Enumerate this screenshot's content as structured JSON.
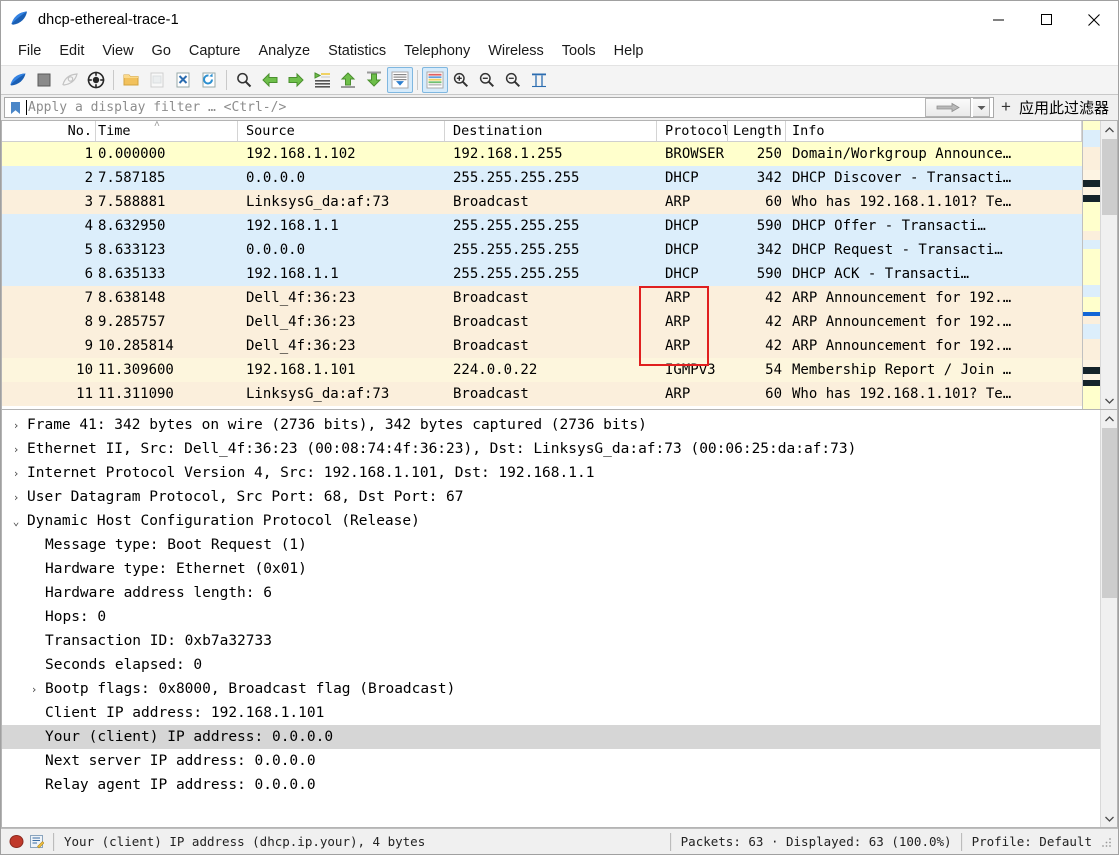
{
  "window": {
    "title": "dhcp-ethereal-trace-1",
    "app_icon": "wireshark-fin-icon",
    "minimize_label": "–",
    "maximize_label": "□",
    "close_label": "✕"
  },
  "menubar": {
    "items": [
      {
        "label": "File",
        "name": "menu-file"
      },
      {
        "label": "Edit",
        "name": "menu-edit"
      },
      {
        "label": "View",
        "name": "menu-view"
      },
      {
        "label": "Go",
        "name": "menu-go"
      },
      {
        "label": "Capture",
        "name": "menu-capture"
      },
      {
        "label": "Analyze",
        "name": "menu-analyze"
      },
      {
        "label": "Statistics",
        "name": "menu-statistics"
      },
      {
        "label": "Telephony",
        "name": "menu-telephony"
      },
      {
        "label": "Wireless",
        "name": "menu-wireless"
      },
      {
        "label": "Tools",
        "name": "menu-tools"
      },
      {
        "label": "Help",
        "name": "menu-help"
      }
    ]
  },
  "toolbar": {
    "buttons": [
      {
        "icon": "start-capture-icon",
        "enabled": true
      },
      {
        "icon": "stop-capture-icon",
        "enabled": true
      },
      {
        "icon": "restart-capture-icon",
        "enabled": false
      },
      {
        "icon": "capture-options-icon",
        "enabled": true
      },
      {
        "sep": true
      },
      {
        "icon": "open-file-icon",
        "enabled": true
      },
      {
        "icon": "save-file-icon",
        "enabled": false
      },
      {
        "icon": "close-file-icon",
        "enabled": true
      },
      {
        "icon": "reload-file-icon",
        "enabled": true
      },
      {
        "sep": true
      },
      {
        "icon": "find-packet-icon",
        "enabled": true
      },
      {
        "icon": "go-back-icon",
        "enabled": true
      },
      {
        "icon": "go-forward-icon",
        "enabled": true
      },
      {
        "icon": "go-to-packet-icon",
        "enabled": true
      },
      {
        "icon": "go-first-packet-icon",
        "enabled": true
      },
      {
        "icon": "go-last-packet-icon",
        "enabled": true
      },
      {
        "icon": "autoscroll-icon",
        "enabled": true,
        "active": true
      },
      {
        "sep": true
      },
      {
        "icon": "colorize-icon",
        "enabled": true,
        "active": true
      },
      {
        "icon": "zoom-in-icon",
        "enabled": true
      },
      {
        "icon": "zoom-out-icon",
        "enabled": true
      },
      {
        "icon": "zoom-reset-icon",
        "enabled": true
      },
      {
        "icon": "resize-columns-icon",
        "enabled": true
      }
    ]
  },
  "filter_bar": {
    "bookmark_icon": "filter-bookmark-icon",
    "value": "",
    "placeholder": "Apply a display filter … <Ctrl-/>",
    "apply_icon": "apply-arrow-icon",
    "dropdown_icon": "chevron-down-icon",
    "add_button_label": "+",
    "hint_label": "应用此过滤器"
  },
  "packet_list": {
    "columns": [
      {
        "label": "No.",
        "name": "column-no"
      },
      {
        "label": "Time",
        "name": "column-time"
      },
      {
        "label": "Source",
        "name": "column-source"
      },
      {
        "label": "Destination",
        "name": "column-destination"
      },
      {
        "label": "Protocol",
        "name": "column-protocol"
      },
      {
        "label": "Length",
        "name": "column-length"
      },
      {
        "label": "Info",
        "name": "column-info"
      }
    ],
    "sorted_column": "Time",
    "sort_indicator": "˄",
    "rows": [
      {
        "no": "1",
        "time": "0.000000",
        "source": "192.168.1.102",
        "destination": "192.168.1.255",
        "protocol": "BROWSER",
        "length": "250",
        "info": "Domain/Workgroup Announce…",
        "bg": "#ffffcc"
      },
      {
        "no": "2",
        "time": "7.587185",
        "source": "0.0.0.0",
        "destination": "255.255.255.255",
        "protocol": "DHCP",
        "length": "342",
        "info": "DHCP Discover  - Transacti…",
        "bg": "#dceefb"
      },
      {
        "no": "3",
        "time": "7.588881",
        "source": "LinksysG_da:af:73",
        "destination": "Broadcast",
        "protocol": "ARP",
        "length": "60",
        "info": "Who has 192.168.1.101? Te…",
        "bg": "#fbefdc"
      },
      {
        "no": "4",
        "time": "8.632950",
        "source": "192.168.1.1",
        "destination": "255.255.255.255",
        "protocol": "DHCP",
        "length": "590",
        "info": "DHCP Offer     - Transacti…",
        "bg": "#dceefb"
      },
      {
        "no": "5",
        "time": "8.633123",
        "source": "0.0.0.0",
        "destination": "255.255.255.255",
        "protocol": "DHCP",
        "length": "342",
        "info": "DHCP Request   - Transacti…",
        "bg": "#dceefb"
      },
      {
        "no": "6",
        "time": "8.635133",
        "source": "192.168.1.1",
        "destination": "255.255.255.255",
        "protocol": "DHCP",
        "length": "590",
        "info": "DHCP ACK       - Transacti…",
        "bg": "#dceefb"
      },
      {
        "no": "7",
        "time": "8.638148",
        "source": "Dell_4f:36:23",
        "destination": "Broadcast",
        "protocol": "ARP",
        "length": "42",
        "info": "ARP Announcement for 192.…",
        "bg": "#fbefdc"
      },
      {
        "no": "8",
        "time": "9.285757",
        "source": "Dell_4f:36:23",
        "destination": "Broadcast",
        "protocol": "ARP",
        "length": "42",
        "info": "ARP Announcement for 192.…",
        "bg": "#fbefdc"
      },
      {
        "no": "9",
        "time": "10.285814",
        "source": "Dell_4f:36:23",
        "destination": "Broadcast",
        "protocol": "ARP",
        "length": "42",
        "info": "ARP Announcement for 192.…",
        "bg": "#fbefdc"
      },
      {
        "no": "10",
        "time": "11.309600",
        "source": "192.168.1.101",
        "destination": "224.0.0.22",
        "protocol": "IGMPv3",
        "length": "54",
        "info": "Membership Report / Join …",
        "bg": "#fdf6dd"
      },
      {
        "no": "11",
        "time": "11.311090",
        "source": "LinksysG_da:af:73",
        "destination": "Broadcast",
        "protocol": "ARP",
        "length": "60",
        "info": "Who has 192.168.1.101? Te…",
        "bg": "#fbefdc"
      }
    ],
    "packet_map_bands": [
      {
        "color": "#ffffcc",
        "h": 10
      },
      {
        "color": "#dceefb",
        "h": 18
      },
      {
        "color": "#fbefdc",
        "h": 10
      },
      {
        "color": "#fbefdc",
        "h": 14
      },
      {
        "color": "#fdf4e3",
        "h": 10
      },
      {
        "color": "#15242b",
        "h": 8
      },
      {
        "color": "#fdf4e3",
        "h": 8
      },
      {
        "color": "#15242b",
        "h": 8
      },
      {
        "color": "#ffffcc",
        "h": 30
      },
      {
        "color": "#fbefdc",
        "h": 10
      },
      {
        "color": "#dceefb",
        "h": 10
      },
      {
        "color": "#ffffcc",
        "h": 38
      },
      {
        "color": "#dceefb",
        "h": 12
      },
      {
        "color": "#ffffcc",
        "h": 16
      },
      {
        "color": "#1266d6",
        "h": 5
      },
      {
        "color": "#fbefdc",
        "h": 8
      },
      {
        "color": "#dceefb",
        "h": 16
      },
      {
        "color": "#fbefdc",
        "h": 22
      },
      {
        "color": "#fdf4e3",
        "h": 8
      },
      {
        "color": "#15242b",
        "h": 7
      },
      {
        "color": "#fdf4e3",
        "h": 6
      },
      {
        "color": "#15242b",
        "h": 7
      },
      {
        "color": "#ffffcc",
        "h": 24
      }
    ],
    "annotation": {
      "name": "red-highlight-box",
      "color": "#e01f1f"
    }
  },
  "detail_pane": {
    "rows": [
      {
        "twisty": "›",
        "indent": 0,
        "text": "Frame 41: 342 bytes on wire (2736 bits), 342 bytes captured (2736 bits)",
        "name": "detail-frame"
      },
      {
        "twisty": "›",
        "indent": 0,
        "text": "Ethernet II, Src: Dell_4f:36:23 (00:08:74:4f:36:23), Dst: LinksysG_da:af:73 (00:06:25:da:af:73)",
        "name": "detail-ethernet"
      },
      {
        "twisty": "›",
        "indent": 0,
        "text": "Internet Protocol Version 4, Src: 192.168.1.101, Dst: 192.168.1.1",
        "name": "detail-ipv4"
      },
      {
        "twisty": "›",
        "indent": 0,
        "text": "User Datagram Protocol, Src Port: 68, Dst Port: 67",
        "name": "detail-udp"
      },
      {
        "twisty": "⌄",
        "indent": 0,
        "text": "Dynamic Host Configuration Protocol (Release)",
        "name": "detail-dhcp"
      },
      {
        "twisty": "",
        "indent": 1,
        "text": "Message type: Boot Request (1)",
        "name": "detail-message-type"
      },
      {
        "twisty": "",
        "indent": 1,
        "text": "Hardware type: Ethernet (0x01)",
        "name": "detail-hardware-type"
      },
      {
        "twisty": "",
        "indent": 1,
        "text": "Hardware address length: 6",
        "name": "detail-hardware-address-length"
      },
      {
        "twisty": "",
        "indent": 1,
        "text": "Hops: 0",
        "name": "detail-hops"
      },
      {
        "twisty": "",
        "indent": 1,
        "text": "Transaction ID: 0xb7a32733",
        "name": "detail-transaction-id"
      },
      {
        "twisty": "",
        "indent": 1,
        "text": "Seconds elapsed: 0",
        "name": "detail-seconds-elapsed"
      },
      {
        "twisty": "›",
        "indent": 1,
        "text": "Bootp flags: 0x8000, Broadcast flag (Broadcast)",
        "name": "detail-bootp-flags"
      },
      {
        "twisty": "",
        "indent": 1,
        "text": "Client IP address: 192.168.1.101",
        "name": "detail-client-ip"
      },
      {
        "twisty": "",
        "indent": 1,
        "text": "Your (client) IP address: 0.0.0.0",
        "name": "detail-your-client-ip",
        "selected": true
      },
      {
        "twisty": "",
        "indent": 1,
        "text": "Next server IP address: 0.0.0.0",
        "name": "detail-next-server-ip"
      },
      {
        "twisty": "",
        "indent": 1,
        "text": "Relay agent IP address: 0.0.0.0",
        "name": "detail-relay-agent-ip"
      }
    ]
  },
  "statusbar": {
    "expert_icon": "expert-info-icon",
    "capture_file_icon": "capture-comment-icon",
    "field_text": "Your (client) IP address (dhcp.ip.your), 4 bytes",
    "packets_text": "Packets: 63 · Displayed: 63 (100.0%)",
    "profile_text": "Profile: Default"
  }
}
